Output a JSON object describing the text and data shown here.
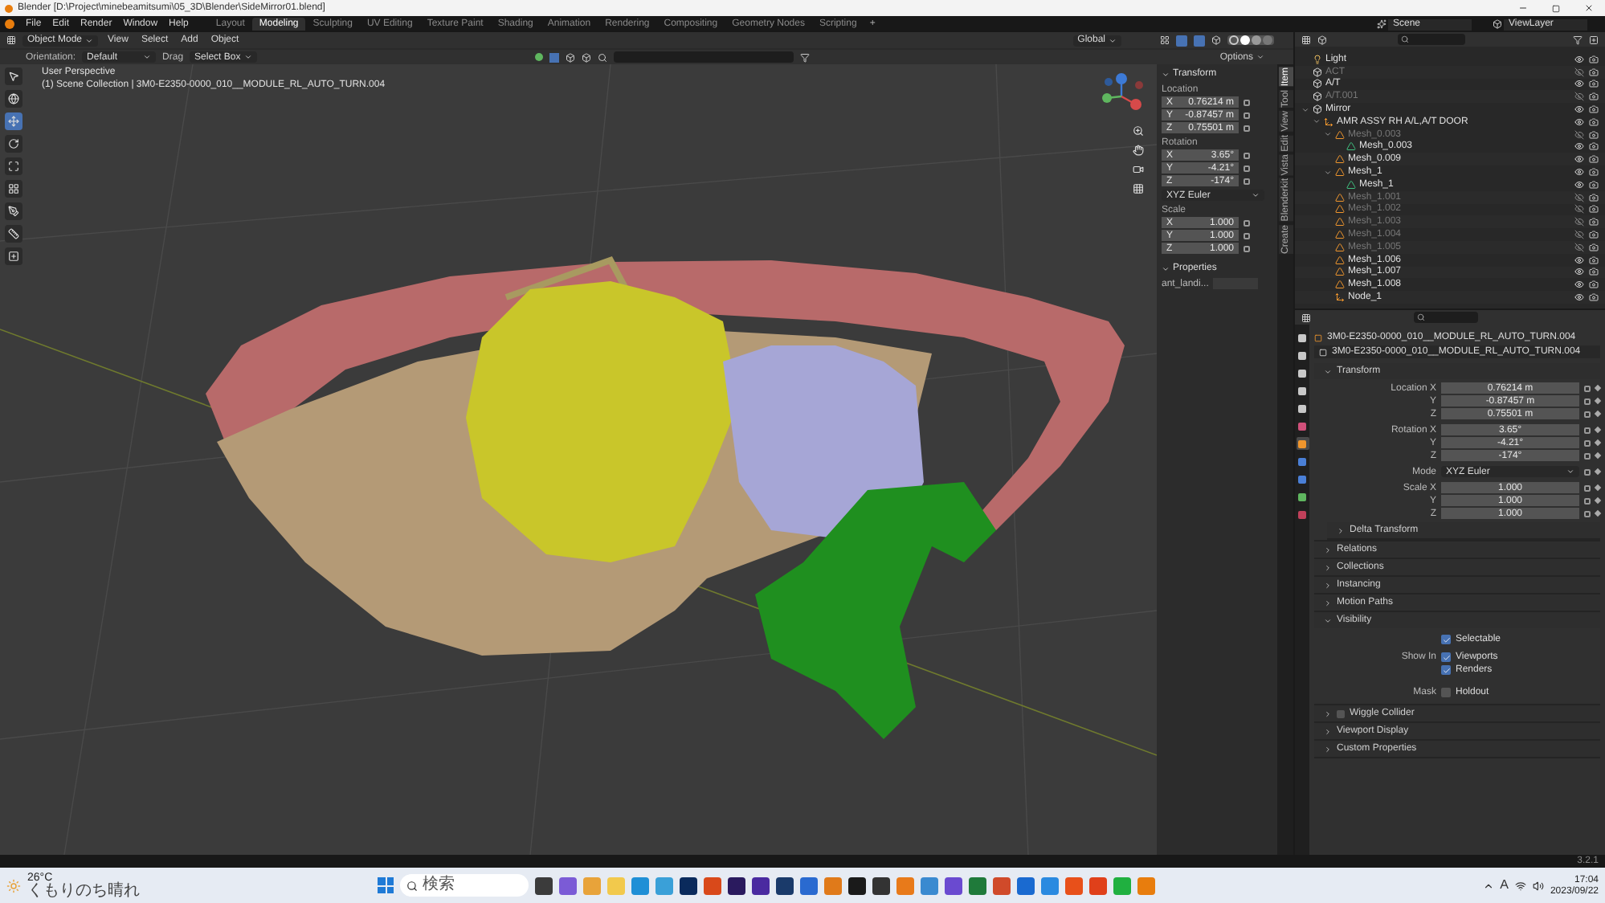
{
  "window": {
    "title": "Blender [D:\\Project\\minebeamitsumi\\05_3D\\Blender\\SideMirror01.blend]"
  },
  "menus": [
    "File",
    "Edit",
    "Render",
    "Window",
    "Help"
  ],
  "workspaces": [
    {
      "label": "Layout",
      "selected": false
    },
    {
      "label": "Modeling",
      "selected": true
    },
    {
      "label": "Sculpting",
      "selected": false
    },
    {
      "label": "UV Editing",
      "selected": false
    },
    {
      "label": "Texture Paint",
      "selected": false
    },
    {
      "label": "Shading",
      "selected": false
    },
    {
      "label": "Animation",
      "selected": false
    },
    {
      "label": "Rendering",
      "selected": false
    },
    {
      "label": "Compositing",
      "selected": false
    },
    {
      "label": "Geometry Nodes",
      "selected": false
    },
    {
      "label": "Scripting",
      "selected": false
    }
  ],
  "workspace_add": "+",
  "scene": {
    "scene": "Scene",
    "view_layer": "ViewLayer"
  },
  "viewport_header": {
    "mode": "Object Mode",
    "menus": [
      "View",
      "Select",
      "Add",
      "Object"
    ],
    "transform_orientation": "Global"
  },
  "tool_settings": {
    "orientation_label": "Orientation:",
    "orientation": "Default",
    "drag_label": "Drag",
    "drag": "Select Box",
    "options": "Options"
  },
  "tools": [
    {
      "selected": false
    },
    {
      "selected": false
    },
    {
      "selected": true
    },
    {
      "selected": false
    },
    {
      "selected": false
    },
    {
      "selected": false
    },
    {
      "selected": false
    },
    {
      "selected": false
    },
    {
      "selected": false
    }
  ],
  "viewport": {
    "view_name": "User Perspective",
    "collection_info": "(1) Scene Collection | 3M0-E2350-0000_010__MODULE_RL_AUTO_TURN.004"
  },
  "n_panel": {
    "title": "Transform",
    "expanded": true,
    "location_label": "Location",
    "location": [
      {
        "axis": "X",
        "value": "0.76214 m"
      },
      {
        "axis": "Y",
        "value": "-0.87457 m"
      },
      {
        "axis": "Z",
        "value": "0.75501 m"
      }
    ],
    "rotation_label": "Rotation",
    "rotation": [
      {
        "axis": "X",
        "value": "3.65°"
      },
      {
        "axis": "Y",
        "value": "-4.21°"
      },
      {
        "axis": "Z",
        "value": "-174°"
      }
    ],
    "rotation_mode": "XYZ Euler",
    "scale_label": "Scale",
    "scale": [
      {
        "axis": "X",
        "value": "1.000"
      },
      {
        "axis": "Y",
        "value": "1.000"
      },
      {
        "axis": "Z",
        "value": "1.000"
      }
    ],
    "properties_title": "Properties",
    "properties_expanded": true,
    "custom_property": "ant_landi..."
  },
  "sidebar_tabs": [
    {
      "label": "Item",
      "selected": true
    },
    {
      "label": "Tool",
      "selected": false
    },
    {
      "label": "View",
      "selected": false
    },
    {
      "label": "Edit",
      "selected": false
    },
    {
      "label": "Vista",
      "selected": false
    },
    {
      "label": "Blenderkit",
      "selected": false
    },
    {
      "label": "Create",
      "selected": false
    }
  ],
  "outliner": {
    "rows": [
      {
        "name": "Light",
        "kind": "light",
        "visible": true
      },
      {
        "name": "ACT",
        "kind": "collection",
        "visible": false
      },
      {
        "name": "A/T",
        "kind": "collection",
        "visible": true
      },
      {
        "name": "A/T.001",
        "kind": "collection",
        "visible": false
      },
      {
        "name": "Mirror",
        "kind": "collection",
        "visible": true,
        "expanded": true,
        "children": [
          {
            "name": "AMR ASSY RH A/L,A/T DOOR",
            "kind": "empty",
            "visible": true,
            "expanded": true,
            "children": [
              {
                "name": "Mesh_0.003",
                "kind": "mesh",
                "visible": false,
                "expanded": true,
                "children": [
                  {
                    "name": "Mesh_0.003",
                    "kind": "mesh_data",
                    "visible": true
                  }
                ]
              },
              {
                "name": "Mesh_0.009",
                "kind": "mesh",
                "visible": true
              },
              {
                "name": "Mesh_1",
                "kind": "mesh",
                "visible": true,
                "expanded": true,
                "children": [
                  {
                    "name": "Mesh_1",
                    "kind": "mesh_data",
                    "visible": true
                  }
                ]
              },
              {
                "name": "Mesh_1.001",
                "kind": "mesh",
                "visible": false
              },
              {
                "name": "Mesh_1.002",
                "kind": "mesh",
                "visible": false
              },
              {
                "name": "Mesh_1.003",
                "kind": "mesh",
                "visible": false
              },
              {
                "name": "Mesh_1.004",
                "kind": "mesh",
                "visible": false
              },
              {
                "name": "Mesh_1.005",
                "kind": "mesh",
                "visible": false
              },
              {
                "name": "Mesh_1.006",
                "kind": "mesh",
                "visible": true
              },
              {
                "name": "Mesh_1.007",
                "kind": "mesh",
                "visible": true
              },
              {
                "name": "Mesh_1.008",
                "kind": "mesh",
                "visible": true
              },
              {
                "name": "Node_1",
                "kind": "empty",
                "visible": true
              }
            ]
          }
        ]
      }
    ]
  },
  "property_tabs": [
    {
      "selected": false,
      "color": "#c8c8c8"
    },
    {
      "selected": false,
      "color": "#c8c8c8"
    },
    {
      "selected": false,
      "color": "#c8c8c8"
    },
    {
      "selected": false,
      "color": "#c8c8c8"
    },
    {
      "selected": false,
      "color": "#c8c8c8"
    },
    {
      "selected": false,
      "color": "#d0507a"
    },
    {
      "selected": true,
      "color": "#f0962d"
    },
    {
      "selected": false,
      "color": "#4a7fd6"
    },
    {
      "selected": false,
      "color": "#4a7fd6"
    },
    {
      "selected": false,
      "color": "#5fb65f"
    },
    {
      "selected": false,
      "color": "#c0405a"
    }
  ],
  "properties": {
    "object_name": "3M0-E2350-0000_010__MODULE_RL_AUTO_TURN.004",
    "data_name": "3M0-E2350-0000_010__MODULE_RL_AUTO_TURN.004",
    "transform": {
      "title": "Transform",
      "expanded": true,
      "rows": [
        {
          "kind": "number",
          "label": "Location X",
          "value": "0.76214 m"
        },
        {
          "kind": "number",
          "label": "Y",
          "value": "-0.87457 m"
        },
        {
          "kind": "number",
          "label": "Z",
          "value": "0.75501 m"
        },
        {
          "kind": "number",
          "label": "Rotation X",
          "value": "3.65°"
        },
        {
          "kind": "number",
          "label": "Y",
          "value": "-4.21°"
        },
        {
          "kind": "number",
          "label": "Z",
          "value": "-174°"
        },
        {
          "kind": "select",
          "label": "Mode",
          "value": "XYZ Euler"
        },
        {
          "kind": "number",
          "label": "Scale X",
          "value": "1.000"
        },
        {
          "kind": "number",
          "label": "Y",
          "value": "1.000"
        },
        {
          "kind": "number",
          "label": "Z",
          "value": "1.000"
        }
      ]
    },
    "sections_before": [
      {
        "title": "Delta Transform",
        "expanded": false
      },
      {
        "title": "Relations",
        "expanded": false
      },
      {
        "title": "Collections",
        "expanded": false
      },
      {
        "title": "Instancing",
        "expanded": false
      },
      {
        "title": "Motion Paths",
        "expanded": false
      }
    ],
    "visibility": {
      "title": "Visibility",
      "expanded": true,
      "rows": [
        {
          "label": "",
          "text": "Selectable",
          "checked": true
        },
        {
          "label": "Show In",
          "text": "Viewports",
          "checked": true
        },
        {
          "label": "",
          "text": "Renders",
          "checked": true
        },
        {
          "label": "Mask",
          "text": "Holdout",
          "checked": false
        }
      ]
    },
    "sections_after": [
      {
        "title": "Wiggle Collider",
        "expanded": false,
        "checked": false
      },
      {
        "title": "Viewport Display",
        "expanded": false
      },
      {
        "title": "Custom Properties",
        "expanded": false
      }
    ]
  },
  "status_bar": {
    "version": "3.2.1"
  },
  "taskbar": {
    "temperature": "26°C",
    "weather": "くもりのち晴れ",
    "search": "検索",
    "ime": "A",
    "time": "17:04",
    "date": "2023/09/22",
    "apps": [
      {
        "color": "#3b3b3b"
      },
      {
        "color": "#7b5bd6"
      },
      {
        "color": "#e8a33a"
      },
      {
        "color": "#f2c94c"
      },
      {
        "color": "#1f8fd6"
      },
      {
        "color": "#3aa0d8"
      },
      {
        "color": "#0a2a5c"
      },
      {
        "color": "#d9491a"
      },
      {
        "color": "#2a1a5e"
      },
      {
        "color": "#4a2aa0"
      },
      {
        "color": "#1a3a6a"
      },
      {
        "color": "#2a6ad0"
      },
      {
        "color": "#e07a1a"
      },
      {
        "color": "#1a1a1a"
      },
      {
        "color": "#333333"
      },
      {
        "color": "#e87a1a"
      },
      {
        "color": "#3a8ad0"
      },
      {
        "color": "#6a4ad0"
      },
      {
        "color": "#1f7a3a"
      },
      {
        "color": "#d04a2a"
      },
      {
        "color": "#1a6ad0"
      },
      {
        "color": "#2a8ae0"
      },
      {
        "color": "#e8501a"
      },
      {
        "color": "#e0401a"
      },
      {
        "color": "#20b040"
      },
      {
        "color": "#e87d0d"
      }
    ]
  }
}
